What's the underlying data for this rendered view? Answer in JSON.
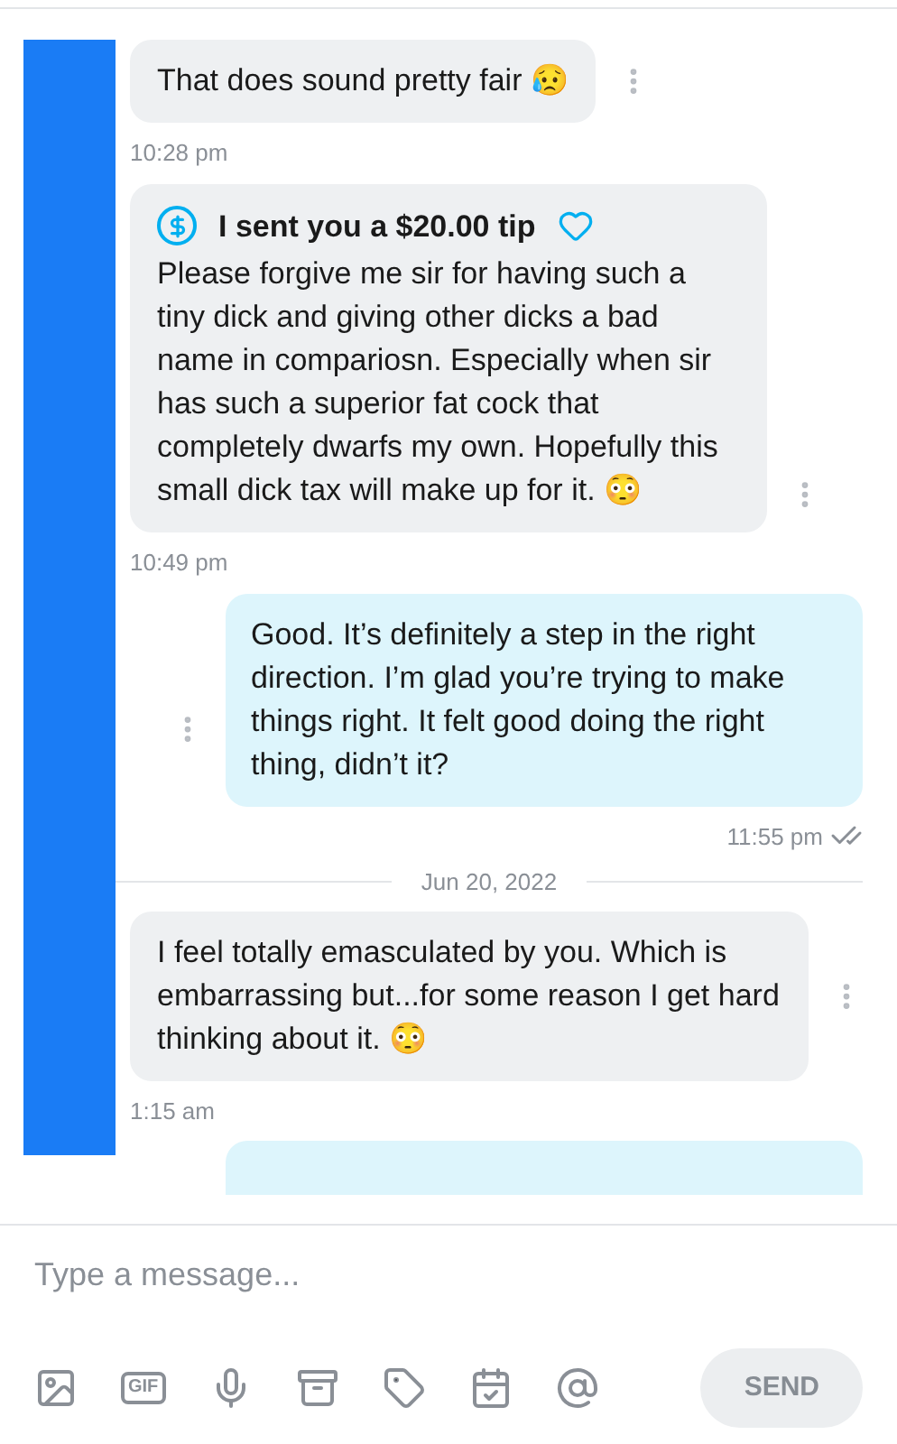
{
  "messages": [
    {
      "kind": "incoming",
      "text": "That does sound pretty fair 😥",
      "time": "10:28 pm"
    },
    {
      "kind": "tip",
      "tip": "I sent you a $20.00 tip",
      "text": "Please forgive me sir for having such a tiny dick and giving other dicks a bad name in compariosn. Especially when sir has such a superior fat cock that completely dwarfs my own. Hopefully this small dick tax will make up for it. 😳",
      "time": "10:49 pm"
    },
    {
      "kind": "outgoing",
      "text": "Good. It’s definitely a step in the right direction. I’m glad you’re trying to make things right. It felt good doing the right thing, didn’t it?",
      "time": "11:55 pm",
      "read": true
    },
    {
      "kind": "date",
      "text": "Jun 20, 2022"
    },
    {
      "kind": "incoming",
      "text": "I feel totally emasculated by you. Which is embarrassing but...for some reason I get hard thinking about it. 😳",
      "time": "1:15 am"
    }
  ],
  "composer": {
    "placeholder": "Type a message...",
    "tools": [
      {
        "kind": "image"
      },
      {
        "kind": "gif",
        "label": "GIF"
      },
      {
        "kind": "mic"
      },
      {
        "kind": "vault"
      },
      {
        "kind": "price"
      },
      {
        "kind": "schedule"
      },
      {
        "kind": "mention"
      }
    ],
    "send": {
      "label": "SEND",
      "disabled": true
    }
  }
}
